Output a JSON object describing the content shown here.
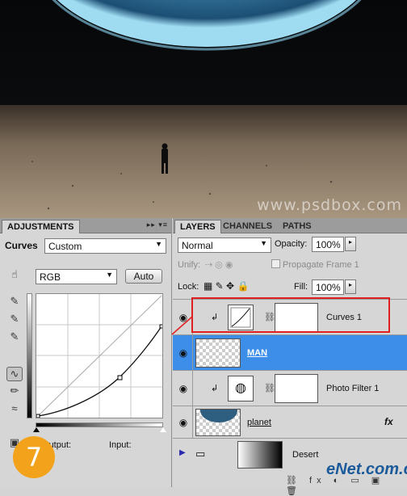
{
  "watermark": "www.psdbox.com",
  "adjustments": {
    "tab_label": "ADJUSTMENTS",
    "panel_menu": "▸▸ ▾≡",
    "curves_label": "Curves",
    "preset_value": "Custom",
    "channel_value": "RGB",
    "auto_label": "Auto",
    "output_label": "Output:",
    "input_label": "Input:"
  },
  "layers_panel": {
    "tabs": [
      "LAYERS",
      "CHANNELS",
      "PATHS"
    ],
    "blend_mode": "Normal",
    "opacity_label": "Opacity:",
    "opacity_value": "100%",
    "unify_label": "Unify:",
    "propagate_label": "Propagate Frame 1",
    "lock_label": "Lock:",
    "fill_label": "Fill:",
    "fill_value": "100%",
    "layers": [
      {
        "name": "Curves 1"
      },
      {
        "name": "MAN"
      },
      {
        "name": "Photo Filter 1"
      },
      {
        "name": "planet"
      },
      {
        "name": "Desert"
      }
    ],
    "fx_label": "fx"
  },
  "step_number": "7",
  "site_logo": "eNet.com.cn"
}
